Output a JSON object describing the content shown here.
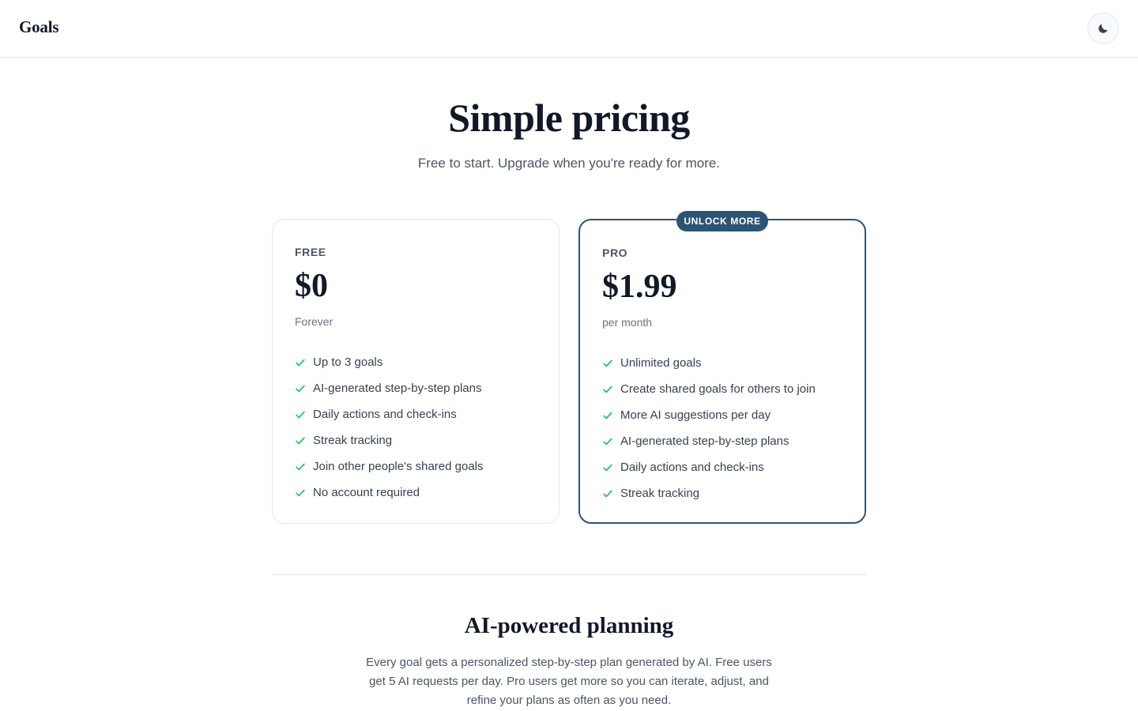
{
  "header": {
    "brand": "Goals",
    "theme_toggle_icon": "moon-icon"
  },
  "hero": {
    "title": "Simple pricing",
    "subtitle": "Free to start. Upgrade when you're ready for more."
  },
  "plans": {
    "free": {
      "name": "FREE",
      "price": "$0",
      "period": "Forever",
      "features": [
        "Up to 3 goals",
        "AI-generated step-by-step plans",
        "Daily actions and check-ins",
        "Streak tracking",
        "Join other people's shared goals",
        "No account required"
      ]
    },
    "pro": {
      "badge": "UNLOCK MORE",
      "name": "PRO",
      "price": "$1.99",
      "period": "per month",
      "features": [
        "Unlimited goals",
        "Create shared goals for others to join",
        "More AI suggestions per day",
        "AI-generated step-by-step plans",
        "Daily actions and check-ins",
        "Streak tracking"
      ]
    }
  },
  "ai_section": {
    "title": "AI-powered planning",
    "body": "Every goal gets a personalized step-by-step plan generated by AI. Free users get 5 AI requests per day. Pro users get more so you can iterate, adjust, and refine your plans as often as you need."
  },
  "colors": {
    "accent": "#2c5473",
    "check": "#22c55e",
    "text": "#111827",
    "muted": "#4b5563",
    "border": "#e5e7eb"
  }
}
